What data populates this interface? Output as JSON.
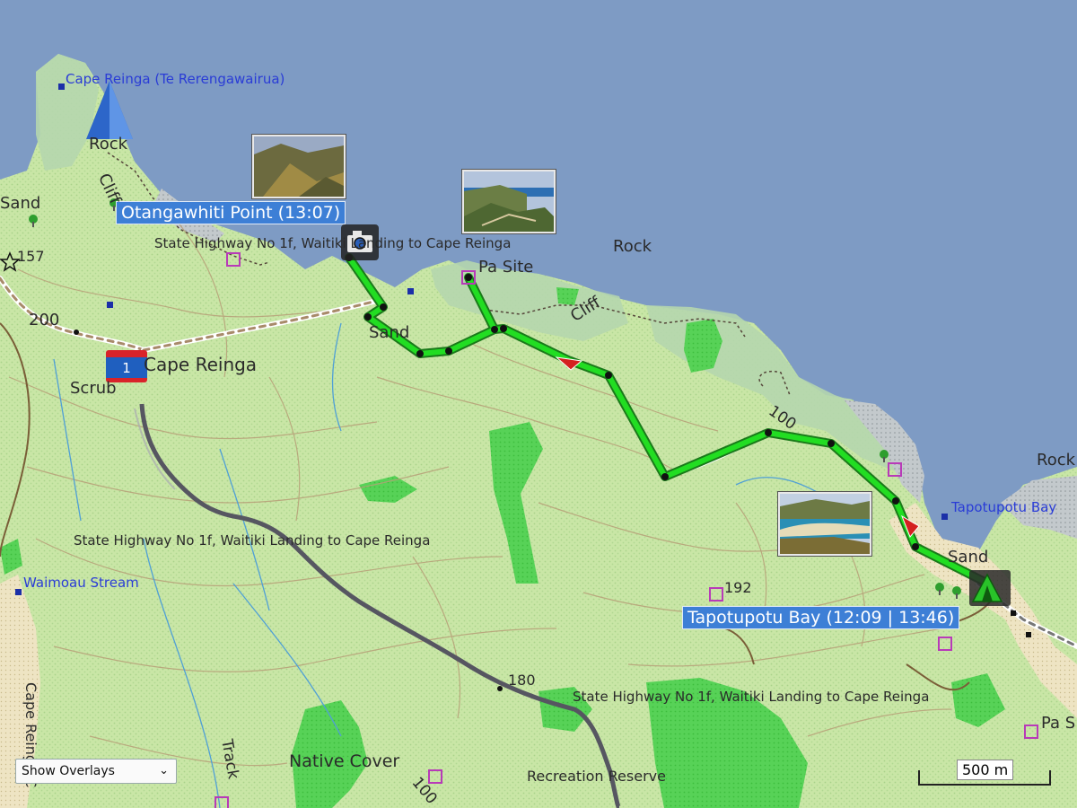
{
  "map": {
    "place_labels": [
      {
        "id": "cape-reinga-te-rerengawairua",
        "text": "Cape Reinga (Te Rerengawairua)",
        "style": "blue"
      },
      {
        "id": "rock-nw",
        "text": "Rock"
      },
      {
        "id": "cliff-nw",
        "text": "Cliff"
      },
      {
        "id": "sand-w",
        "text": "Sand"
      },
      {
        "id": "elev-157",
        "text": "157"
      },
      {
        "id": "elev-200",
        "text": "200"
      },
      {
        "id": "cape-reinga",
        "text": "Cape Reinga"
      },
      {
        "id": "scrub",
        "text": "Scrub"
      },
      {
        "id": "sand-mid",
        "text": "Sand"
      },
      {
        "id": "pa-site",
        "text": "Pa Site"
      },
      {
        "id": "rock-mid",
        "text": "Rock"
      },
      {
        "id": "cliff-mid",
        "text": "Cliff"
      },
      {
        "id": "elev-100-e",
        "text": "100"
      },
      {
        "id": "rock-e",
        "text": "Rock"
      },
      {
        "id": "tapotupotu-bay",
        "text": "Tapotupotu Bay",
        "style": "blue"
      },
      {
        "id": "sand-e",
        "text": "Sand"
      },
      {
        "id": "elev-192",
        "text": "192"
      },
      {
        "id": "hwy-label-1",
        "text": "State Highway No 1f, Waitiki Landing to Cape Reinga"
      },
      {
        "id": "hwy-label-2",
        "text": "State Highway No 1f, Waitiki Landing to Cape Reinga"
      },
      {
        "id": "hwy-label-3",
        "text": "State Highway No 1f, Waitiki Landing to Cape Reinga"
      },
      {
        "id": "waimoau-stream",
        "text": "Waimoau Stream",
        "style": "blue"
      },
      {
        "id": "elev-180",
        "text": "180"
      },
      {
        "id": "native-cover",
        "text": "Native Cover"
      },
      {
        "id": "recreation-reserve",
        "text": "Recreation Reserve"
      },
      {
        "id": "track",
        "text": "Track"
      },
      {
        "id": "elev-100-s",
        "text": "100"
      },
      {
        "id": "cape-reinga-vert",
        "text": "Cape Reinga C"
      },
      {
        "id": "pa-s",
        "text": "Pa S"
      }
    ],
    "highway_shield": "1",
    "callouts": {
      "otangawhiti": "Otangawhiti Point (13:07)",
      "tapotupotu": "Tapotupotu Bay (12:09 | 13:46)"
    },
    "overlay_select": {
      "value": "Show Overlays"
    },
    "scale": "500 m",
    "colors": {
      "sea": "#7e9bc4",
      "land": "#c6e3a4",
      "forest": "#55d055",
      "track": "#22dd22",
      "track_border": "#1a7a1a",
      "road": "#565661",
      "callout": "#3d7fd6"
    },
    "icons": [
      "cape-pyramid-icon",
      "camera-icon",
      "campsite-icon",
      "direction-arrow-icon",
      "point-of-interest-icon",
      "tree-icon",
      "summit-star-icon"
    ]
  }
}
